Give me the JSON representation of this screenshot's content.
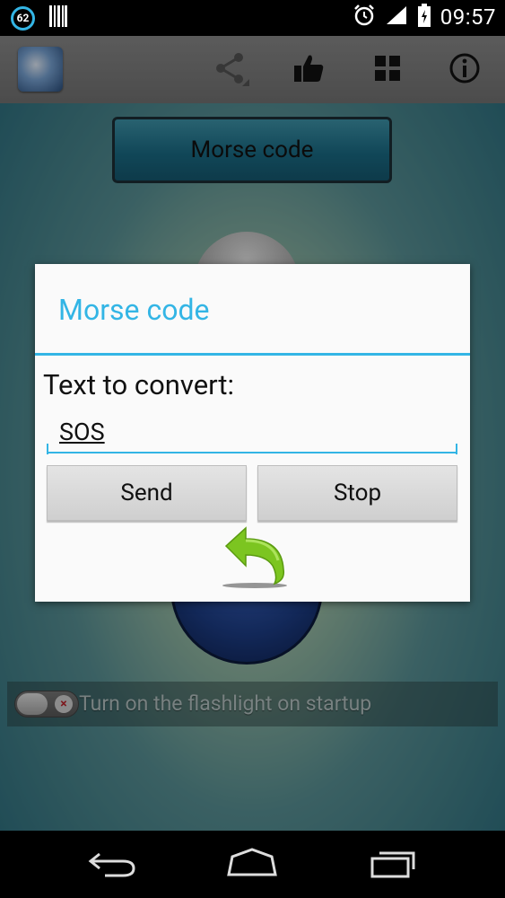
{
  "status_bar": {
    "notification_count": "62",
    "time": "09:57"
  },
  "action_bar": {
    "icons": [
      "app-icon",
      "share-icon",
      "thumbs-up-icon",
      "grid-icon",
      "info-icon"
    ]
  },
  "main": {
    "morse_button_label": "Morse code",
    "startup_toggle_label": "Turn on the flashlight on startup",
    "startup_toggle_on": false
  },
  "dialog": {
    "title": "Morse code",
    "prompt": "Text to convert:",
    "input_value": "SOS",
    "send_label": "Send",
    "stop_label": "Stop"
  },
  "colors": {
    "accent": "#33b5e5",
    "arrow_green": "#7cc520"
  }
}
